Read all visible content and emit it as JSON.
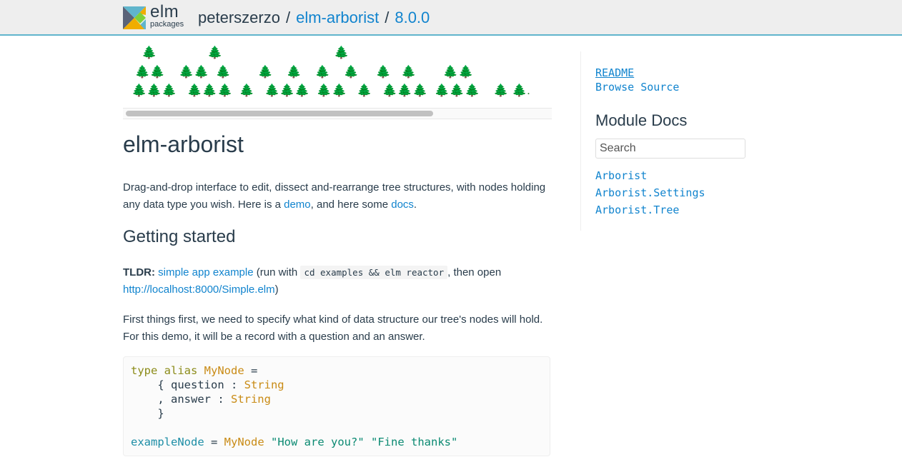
{
  "header": {
    "logo_elm": "elm",
    "logo_packages": "packages",
    "user": "peterszerzo",
    "separator": "/",
    "package": "elm-arborist",
    "version": "8.0.0"
  },
  "banner": {
    "rows": [
      "   🌲               🌲                                 🌲",
      " 🌲🌲    🌲🌲  🌲        🌲    🌲    🌲    🌲     🌲   🌲        🌲🌲",
      "🌲🌲🌲   🌲🌲🌲  🌲   🌲🌲🌲  🌲🌲   🌲   🌲🌲🌲  🌲🌲🌲    🌲 🌲."
    ]
  },
  "readme": {
    "title": "elm-arborist",
    "intro_text": "Drag-and-drop interface to edit, dissect and-rearrange tree structures, with nodes holding any data type you wish. Here is a ",
    "demo_link": "demo",
    "intro_mid": ", and here some ",
    "docs_link": "docs",
    "intro_end": ".",
    "getting_started": "Getting started",
    "tldr_label": "TLDR:",
    "simple_app_link": "simple app example",
    "tldr_run": " (run with ",
    "tldr_code": "cd examples && elm reactor",
    "tldr_then": ", then open",
    "localhost_link": "http://localhost:8000/Simple.elm",
    "tldr_close": ")",
    "first_things": "First things first, we need to specify what kind of data structure our tree's nodes will hold. For this demo, it will be a record with a question and an answer."
  },
  "code": {
    "l1_kw": "type alias",
    "l1_ty": "MyNode",
    "l1_eq": " =",
    "l2_a": "    { question : ",
    "l2_ty": "String",
    "l3_a": "    , answer : ",
    "l3_ty": "String",
    "l4": "    }",
    "l6_fn": "exampleNode",
    "l6_eq": " = ",
    "l6_ty": "MyNode",
    "l6_s1": "\"How are you?\"",
    "l6_s2": "\"Fine thanks\""
  },
  "sidebar": {
    "readme": "README",
    "browse_source": "Browse Source",
    "module_docs": "Module Docs",
    "search_placeholder": "Search",
    "modules": [
      "Arborist",
      "Arborist.Settings",
      "Arborist.Tree"
    ]
  }
}
